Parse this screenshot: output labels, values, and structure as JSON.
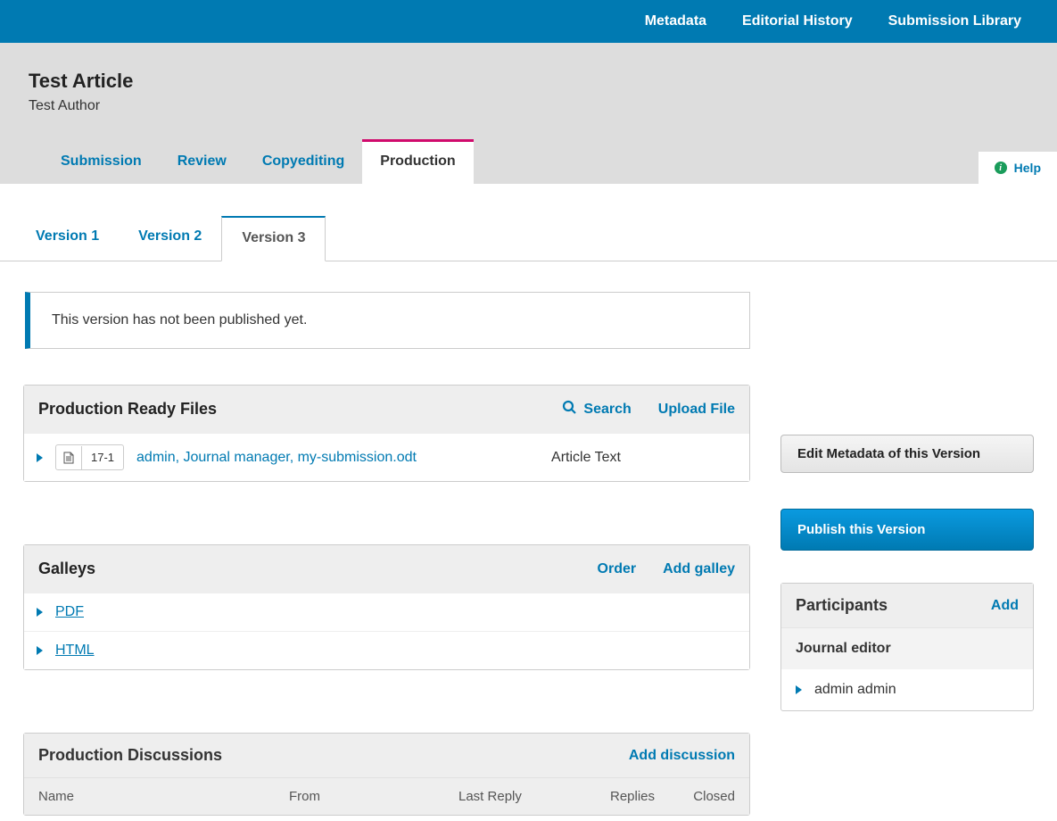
{
  "topnav": {
    "metadata": "Metadata",
    "editorial_history": "Editorial History",
    "submission_library": "Submission Library"
  },
  "article": {
    "title": "Test Article",
    "author": "Test Author"
  },
  "workflow_tabs": {
    "submission": "Submission",
    "review": "Review",
    "copyediting": "Copyediting",
    "production": "Production"
  },
  "help_label": "Help",
  "version_tabs": {
    "v1": "Version 1",
    "v2": "Version 2",
    "v3": "Version 3"
  },
  "info_message": "This version has not been published yet.",
  "files_panel": {
    "title": "Production Ready Files",
    "search": "Search",
    "upload": "Upload File",
    "row": {
      "id": "17-1",
      "name": "admin, Journal manager, my-submission.odt",
      "type": "Article Text"
    }
  },
  "galleys_panel": {
    "title": "Galleys",
    "order": "Order",
    "add": "Add galley",
    "items": {
      "pdf": "PDF",
      "html": "HTML"
    }
  },
  "right": {
    "edit_metadata": "Edit Metadata of this Version",
    "publish": "Publish this Version",
    "participants": {
      "title": "Participants",
      "add": "Add",
      "role": "Journal editor",
      "user": "admin admin"
    }
  },
  "discussions": {
    "title": "Production Discussions",
    "add": "Add discussion",
    "cols": {
      "name": "Name",
      "from": "From",
      "last_reply": "Last Reply",
      "replies": "Replies",
      "closed": "Closed"
    }
  }
}
